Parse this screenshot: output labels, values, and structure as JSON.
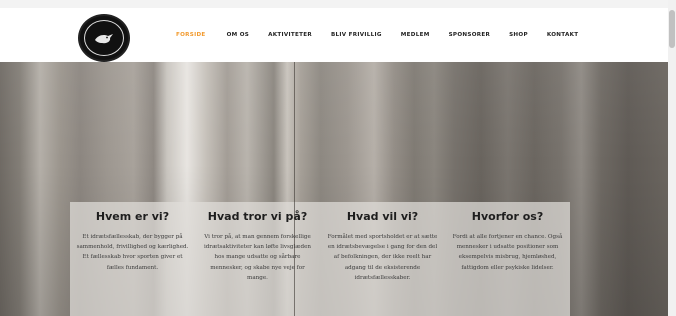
{
  "header": {
    "nav": [
      {
        "label": "FORSIDE",
        "active": true
      },
      {
        "label": "OM OS",
        "active": false
      },
      {
        "label": "AKTIVITETER",
        "active": false
      },
      {
        "label": "BLIV FRIVILLIG",
        "active": false
      },
      {
        "label": "MEDLEM",
        "active": false
      },
      {
        "label": "SPONSORER",
        "active": false
      },
      {
        "label": "SHOP",
        "active": false
      },
      {
        "label": "KONTAKT",
        "active": false
      }
    ],
    "accent_color": "#f29a2e"
  },
  "hero": {
    "columns": [
      {
        "title": "Hvem er vi?",
        "text": "Et idrætsfællesskab, der bygger på sammenhold, frivillighed og kærlighed. Et fællesskab hvor sporten giver et fælles fundament."
      },
      {
        "title": "Hvad tror vi på?",
        "text": "Vi tror på, at man gennem forskellige idrætsaktiviteter kan løfte livsglæden hos mange udsatte og sårbare mennesker, og skabe nye veje for mange."
      },
      {
        "title": "Hvad vil vi?",
        "text": "Formålet med sportsholdet er at sætte en idrætsbevægelse i gang for den del af befolkningen, der ikke reelt har adgang til de eksisterende idrætsfællesskaber."
      },
      {
        "title": "Hvorfor os?",
        "text": "Fordi at alle fortjener en chance. Også mennesker i udsatte positioner som eksempelvis misbrug, hjemløshed, fattigdom eller psykiske lidelser."
      }
    ]
  }
}
